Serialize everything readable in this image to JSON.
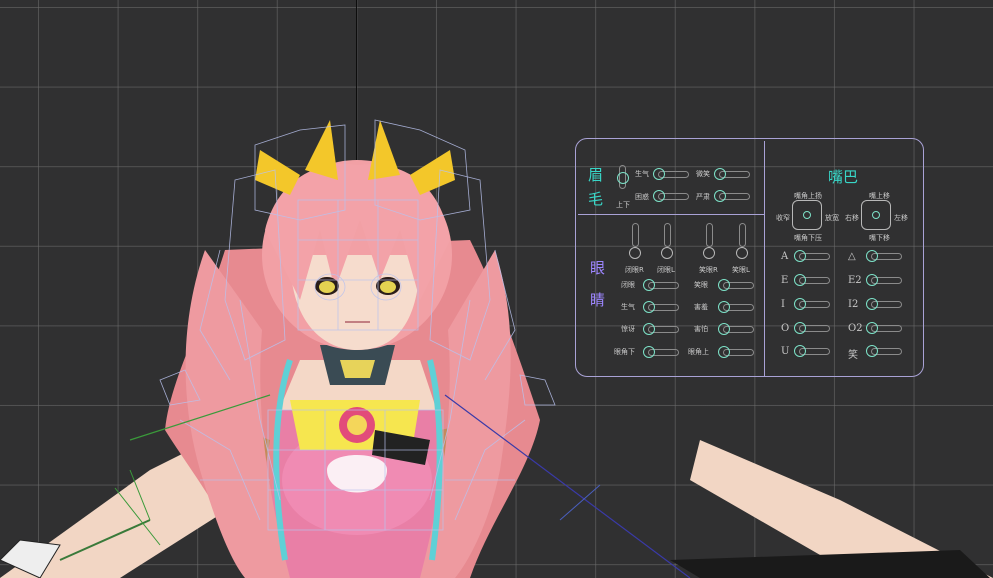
{
  "panel": {
    "brow_title_1": "眉",
    "brow_title_2": "毛",
    "brow_updown": "上下",
    "brow_sliders": [
      "生气",
      "困惑",
      "微笑",
      "严肃"
    ],
    "eye_title_1": "眼",
    "eye_title_2": "睛",
    "eye_vertical": [
      "闭眼R",
      "闭眼L",
      "笑眼R",
      "笑眼L"
    ],
    "eye_sliders_left": [
      "闭眼",
      "生气",
      "惊讶",
      "眼角下"
    ],
    "eye_sliders_right": [
      "笑眼",
      "害羞",
      "害怕",
      "眼角上"
    ],
    "mouth_title": "嘴巴",
    "mouth_pad1": {
      "top": "嘴角上扬",
      "bottom": "嘴角下压",
      "left": "收窄",
      "right": "放宽"
    },
    "mouth_pad2": {
      "top": "嘴上移",
      "bottom": "嘴下移",
      "left": "右移",
      "right": "左移"
    },
    "mouth_left": [
      "A",
      "E",
      "I",
      "O",
      "U"
    ],
    "mouth_right": [
      "△",
      "E2",
      "I2",
      "O2",
      "笑"
    ]
  },
  "colors": {
    "accent_cyan": "#38d6c7",
    "accent_purple": "#9d86ff",
    "panel_border": "#a9a2d6"
  }
}
